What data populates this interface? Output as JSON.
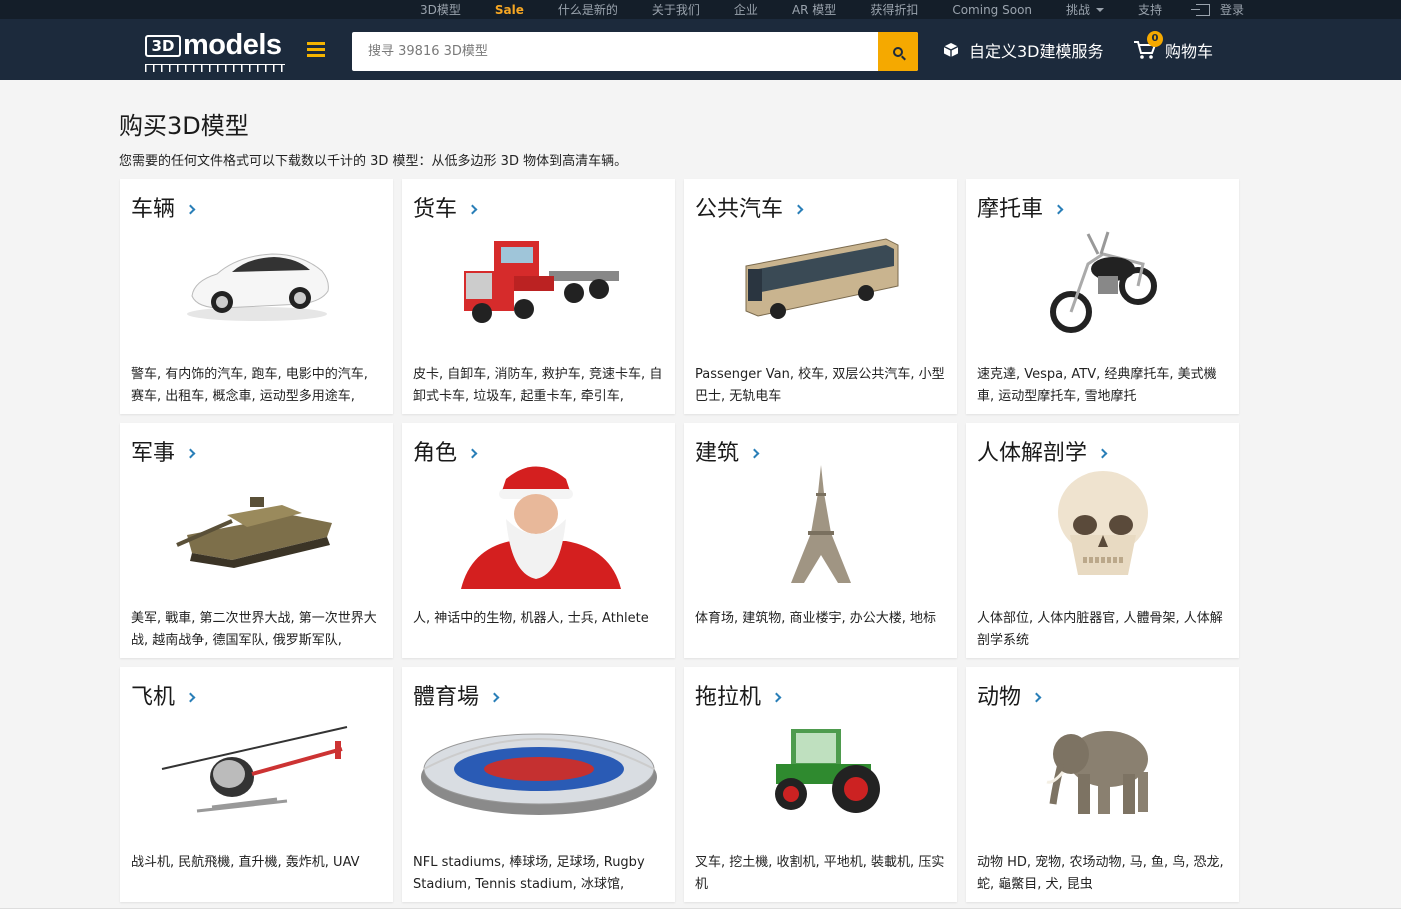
{
  "topnav": {
    "items": [
      "3D模型",
      "Sale",
      "什么是新的",
      "关于我们",
      "企业",
      "AR 模型",
      "获得折扣",
      "Coming Soon",
      "挑战",
      "支持",
      "登录"
    ]
  },
  "header": {
    "logo_text": "models",
    "logo_badge": "3D",
    "search_placeholder": "搜寻 39816 3D模型",
    "service_label": "自定义3D建模服务",
    "cart_label": "购物车",
    "cart_count": "0"
  },
  "main": {
    "title": "购买3D模型",
    "subtitle": "您需要的任何文件格式可以下载数以千计的 3D 模型：从低多边形 3D 物体到高清车辆。"
  },
  "categories": [
    {
      "title": "车辆",
      "tags": "警车, 有内饰的汽车, 跑车, 电影中的汽车, 赛车, 出租车, 概念車, 运动型多用途车,",
      "icon": "car-image"
    },
    {
      "title": "货车",
      "tags": "皮卡, 自卸车, 消防车, 救护车, 竞速卡车, 自卸式卡车, 垃圾车, 起重卡车, 牵引车,",
      "icon": "truck-image"
    },
    {
      "title": "公共汽车",
      "tags": "Passenger Van, 校车, 双层公共汽车, 小型巴士, 无轨电车",
      "icon": "bus-image"
    },
    {
      "title": "摩托車",
      "tags": "速克達, Vespa, ATV, 经典摩托车, 美式機車, 运动型摩托车, 雪地摩托",
      "icon": "motorcycle-image"
    },
    {
      "title": "军事",
      "tags": "美军, 戰車, 第二次世界大战, 第一次世界大战, 越南战争, 德国军队, 俄罗斯军队,",
      "icon": "tank-image"
    },
    {
      "title": "角色",
      "tags": "人, 神话中的生物, 机器人, 士兵, Athlete",
      "icon": "santa-image"
    },
    {
      "title": "建筑",
      "tags": "体育场, 建筑物, 商业楼宇, 办公大楼, 地标",
      "icon": "eiffel-tower-image"
    },
    {
      "title": "人体解剖学",
      "tags": "人体部位, 人体内脏器官, 人體骨架, 人体解剖学系统",
      "icon": "skull-image"
    },
    {
      "title": "飞机",
      "tags": "战斗机, 民航飛機, 直升機, 轰炸机, UAV",
      "icon": "helicopter-image"
    },
    {
      "title": "體育場",
      "tags": "NFL stadiums, 棒球场, 足球场, Rugby Stadium, Tennis stadium, 冰球馆,",
      "icon": "stadium-image"
    },
    {
      "title": "拖拉机",
      "tags": "叉车, 挖土機, 收割机, 平地机, 裝載机, 压实机",
      "icon": "tractor-image"
    },
    {
      "title": "动物",
      "tags": "动物 HD, 宠物, 农场动物, 马, 鱼, 鸟, 恐龙, 蛇, 龜鱉目, 犬, 昆虫",
      "icon": "elephant-image"
    }
  ],
  "colors": {
    "topbar": "#141e29",
    "header": "#1c2a3c",
    "accent": "#f5a900",
    "link": "#2a7fb8"
  }
}
